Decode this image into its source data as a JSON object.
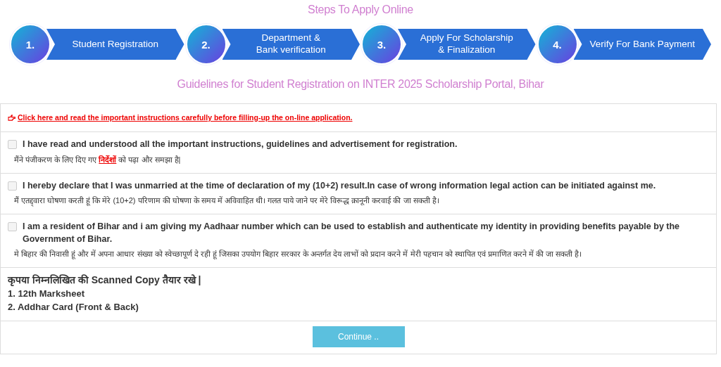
{
  "steps_title": "Steps To Apply Online",
  "steps": [
    {
      "number": "1.",
      "label": "Student Registration"
    },
    {
      "number": "2.",
      "label": "Department &\nBank verification"
    },
    {
      "number": "3.",
      "label": "Apply For Scholarship\n& Finalization"
    },
    {
      "number": "4.",
      "label": "Verify For Bank Payment"
    }
  ],
  "guidelines_title": "Guidelines for Student Registration on INTER 2025 Scholarship Portal, Bihar",
  "instructions_link": "Click here and read the important instructions carefully before filling-up the on-line application.",
  "declarations": [
    {
      "checked": false,
      "text": "I have read and understood all the important instructions, guidelines and advertisement for registration.",
      "hindi": [
        {
          "kind": "text",
          "text": "मैंने पंजीकरण के लिए दिए गए "
        },
        {
          "kind": "link",
          "text": "निर्देशों"
        },
        {
          "kind": "text",
          "text": " को पढ़ा और समझा है|"
        }
      ]
    },
    {
      "checked": false,
      "text": "I hereby declare that I was unmarried at the time of declaration of my (10+2) result.In case of wrong information legal action can be initiated against me.",
      "hindi": [
        {
          "kind": "text",
          "text": "मैं एतद्द्वारा घोषणा करती हूं कि मेरे (10+2) परिणाम की घोषणा के समय में अविवाहित थी। गलत पाये जाने पर मेरे विरूद्ध क़ानूनी करवाई की जा सकती है।"
        }
      ]
    },
    {
      "checked": false,
      "text": "I am a resident of Bihar and i am giving my Aadhaar number which can be used to establish and authenticate my identity in providing benefits payable by the Government of Bihar.",
      "hindi": [
        {
          "kind": "text",
          "text": "मे बिहार की निवासी हूं और में अपना आधार संख्या को स्वेच्छापूर्ण दे रही हूं जिसका उपयोग बिहार सरकार के अन्तर्गत देय लाभों को प्रदान करने में मेरी पहचान को स्थापित एवं प्रमाणित करने में की जा सकती है।"
        }
      ]
    }
  ],
  "documents": {
    "heading": "कृपया निम्नलिखित की Scanned Copy तैयार रखे |",
    "items": [
      "1. 12th Marksheet",
      "2. Addhar Card (Front & Back)"
    ]
  },
  "continue_button": "Continue .."
}
